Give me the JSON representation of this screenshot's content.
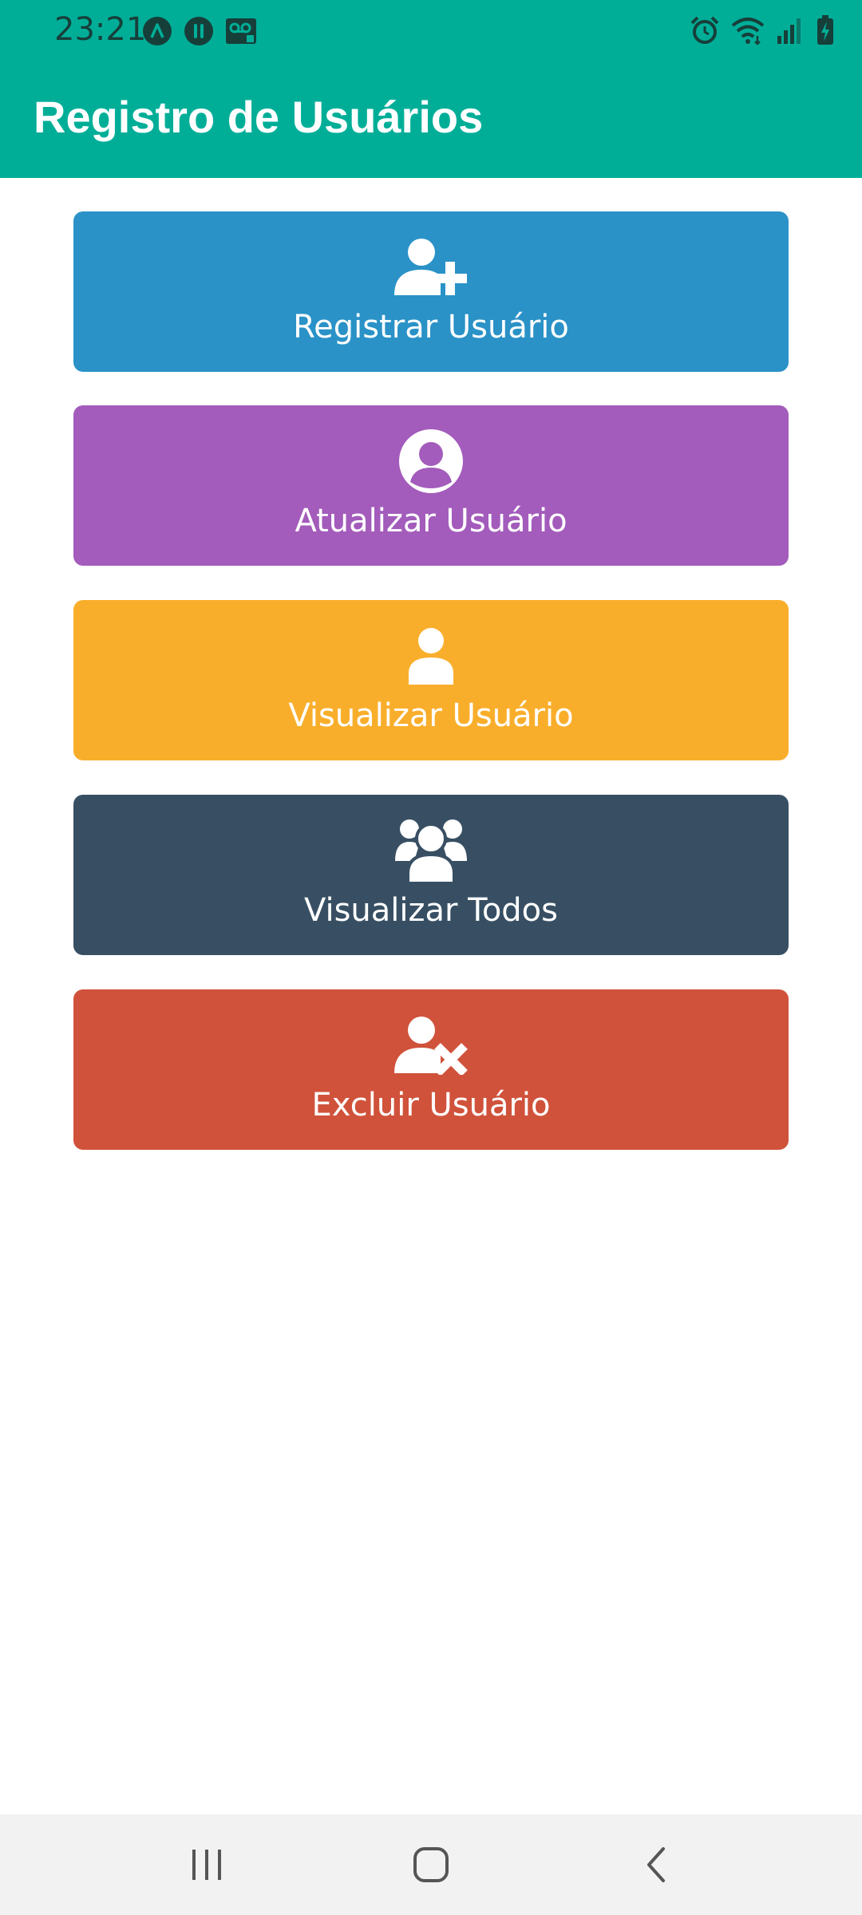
{
  "status_bar": {
    "time": "23:21",
    "left_icons": [
      "expo-icon",
      "notification-app-icon",
      "voicemail-icon"
    ],
    "right_icons": [
      "alarm-icon",
      "wifi-icon",
      "signal-icon",
      "battery-charging-icon"
    ]
  },
  "app_bar": {
    "title": "Registro de Usuários",
    "background_color": "#00ae98"
  },
  "menu": [
    {
      "label": "Registrar Usuário",
      "icon": "user-plus-icon",
      "color": "#2a92c7"
    },
    {
      "label": "Atualizar Usuário",
      "icon": "user-circle-icon",
      "color": "#a35cbb"
    },
    {
      "label": "Visualizar Usuário",
      "icon": "user-icon",
      "color": "#f9ae2b"
    },
    {
      "label": "Visualizar Todos",
      "icon": "users-icon",
      "color": "#384f63"
    },
    {
      "label": "Excluir Usuário",
      "icon": "user-times-icon",
      "color": "#d0523b"
    }
  ],
  "nav_bar": {
    "buttons": [
      "recent-apps-icon",
      "home-icon",
      "back-icon"
    ]
  }
}
